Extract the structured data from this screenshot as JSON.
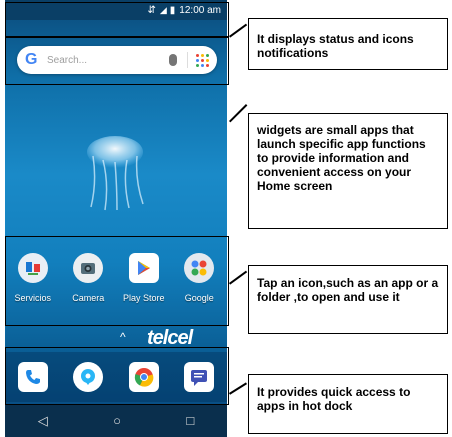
{
  "statusbar": {
    "time": "12:00 am"
  },
  "search": {
    "placeholder": "Search..."
  },
  "apps": [
    {
      "label": "Servicios"
    },
    {
      "label": "Camera"
    },
    {
      "label": "Play Store"
    },
    {
      "label": "Google"
    }
  ],
  "brand": {
    "name": "telcel"
  },
  "nav": {
    "back": "◁",
    "home": "○",
    "recents": "□"
  },
  "callouts": {
    "status": "It displays status and icons notifications",
    "widgets": "widgets are small apps that launch specific app functions to provide information and convenient access on your Home screen",
    "icons": "Tap an icon,such as an app or a folder ,to open and use it",
    "dock": "It provides quick access to apps in hot dock"
  },
  "colors": {
    "google_blue": "#4285f4",
    "google_red": "#ea4335",
    "google_yellow": "#fbbc05",
    "google_green": "#34a853"
  }
}
